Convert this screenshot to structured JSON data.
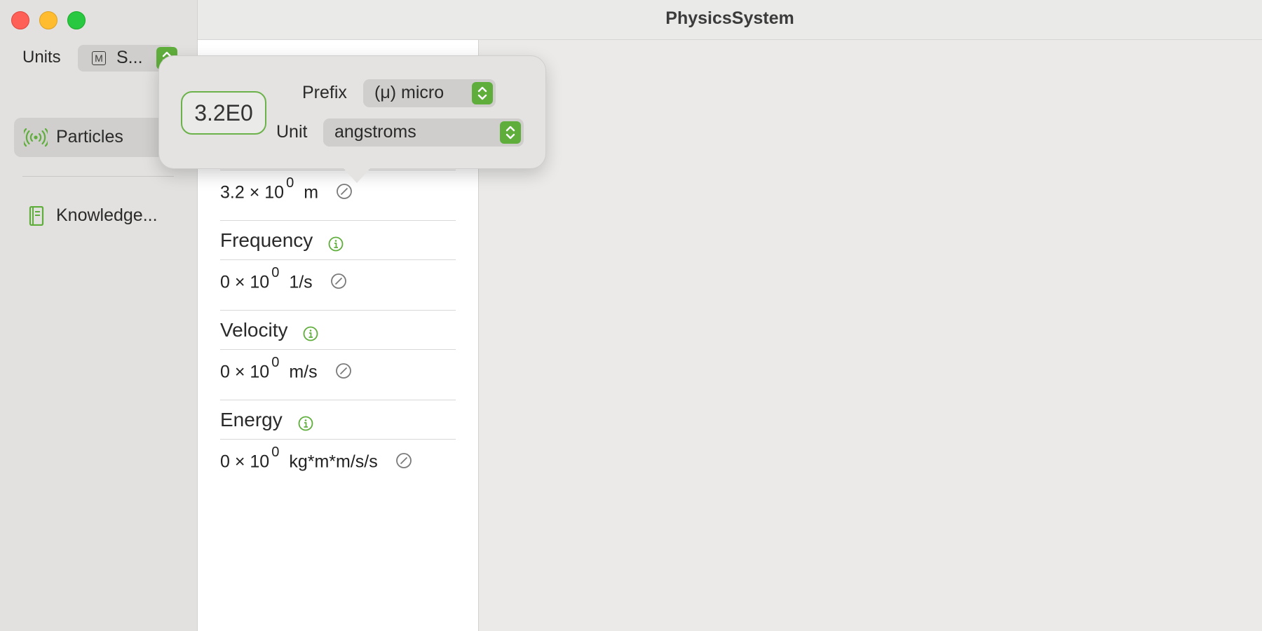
{
  "app": {
    "title": "PhysicsSystem"
  },
  "sidebar": {
    "units_label": "Units",
    "units_icon_letter": "M",
    "units_value": "S...",
    "items": [
      {
        "label": "Particles",
        "icon": "broadcast-icon",
        "selected": true
      },
      {
        "label": "Knowledge...",
        "icon": "book-icon",
        "selected": false
      }
    ]
  },
  "list": {
    "rows": [
      {
        "type": "value",
        "mantissa": "3.2 × 10",
        "exponent": "0",
        "unit": "m"
      },
      {
        "type": "header",
        "label": "Frequency"
      },
      {
        "type": "value",
        "mantissa": "0 × 10",
        "exponent": "0",
        "unit": "1/s"
      },
      {
        "type": "header",
        "label": "Velocity"
      },
      {
        "type": "value",
        "mantissa": "0 × 10",
        "exponent": "0",
        "unit": "m/s"
      },
      {
        "type": "header",
        "label": "Energy"
      },
      {
        "type": "value",
        "mantissa": "0 × 10",
        "exponent": "0",
        "unit": "kg*m*m/s/s"
      }
    ]
  },
  "popover": {
    "number_value": "3.2E0",
    "prefix_label": "Prefix",
    "prefix_value": "(μ) micro",
    "unit_label": "Unit",
    "unit_value": "angstroms"
  },
  "colors": {
    "accent": "#5fae3c",
    "accent_outline": "#6cb24a"
  }
}
